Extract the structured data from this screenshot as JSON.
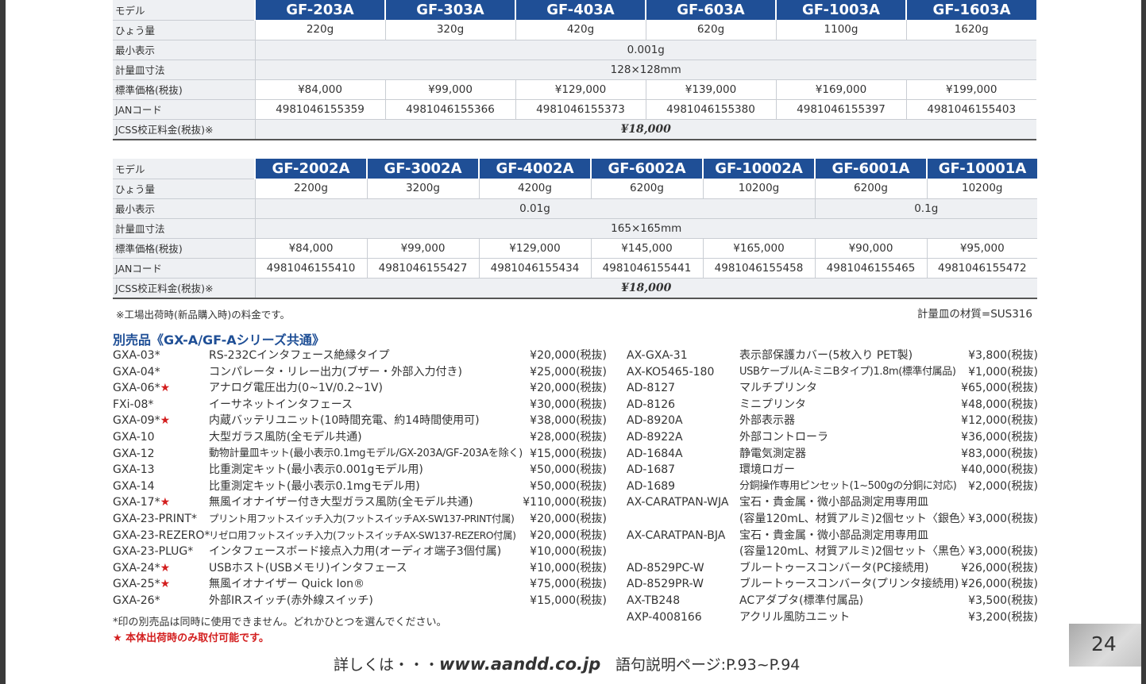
{
  "table1": {
    "rows": {
      "model": "モデル",
      "capacity": "ひょう量",
      "resolution": "最小表示",
      "pan": "計量皿寸法",
      "price": "標準価格(税抜)",
      "jan": "JANコード",
      "jcss": "JCSS校正料金(税抜)※"
    },
    "models": [
      "GF-203A",
      "GF-303A",
      "GF-403A",
      "GF-603A",
      "GF-1003A",
      "GF-1603A"
    ],
    "capacity": [
      "220g",
      "320g",
      "420g",
      "620g",
      "1100g",
      "1620g"
    ],
    "resolution": "0.001g",
    "pan": "128×128mm",
    "price": [
      "¥84,000",
      "¥99,000",
      "¥129,000",
      "¥139,000",
      "¥169,000",
      "¥199,000"
    ],
    "jan": [
      "4981046155359",
      "4981046155366",
      "4981046155373",
      "4981046155380",
      "4981046155397",
      "4981046155403"
    ],
    "jcss": "¥18,000"
  },
  "table2": {
    "rows": {
      "model": "モデル",
      "capacity": "ひょう量",
      "resolution": "最小表示",
      "pan": "計量皿寸法",
      "price": "標準価格(税抜)",
      "jan": "JANコード",
      "jcss": "JCSS校正料金(税抜)※"
    },
    "models": [
      "GF-2002A",
      "GF-3002A",
      "GF-4002A",
      "GF-6002A",
      "GF-10002A",
      "GF-6001A",
      "GF-10001A"
    ],
    "capacity": [
      "2200g",
      "3200g",
      "4200g",
      "6200g",
      "10200g",
      "6200g",
      "10200g"
    ],
    "resolution_a": "0.01g",
    "resolution_b": "0.1g",
    "pan": "165×165mm",
    "price": [
      "¥84,000",
      "¥99,000",
      "¥129,000",
      "¥145,000",
      "¥165,000",
      "¥90,000",
      "¥95,000"
    ],
    "jan": [
      "4981046155410",
      "4981046155427",
      "4981046155434",
      "4981046155441",
      "4981046155458",
      "4981046155465",
      "4981046155472"
    ],
    "jcss": "¥18,000"
  },
  "notes": {
    "factory": "※工場出荷時(新品購入時)の料金です。",
    "pan_material": "計量皿の材質=SUS316"
  },
  "accessories": {
    "title": "別売品《GX-A/GF-Aシリーズ共通》",
    "left": [
      {
        "code": "GXA-03*",
        "red": "",
        "desc": "RS-232Cインタフェース絶縁タイプ",
        "price": "¥20,000(税抜)"
      },
      {
        "code": "GXA-04*",
        "red": "",
        "desc": "コンパレータ・リレー出力(ブザー・外部入力付き)",
        "price": "¥25,000(税抜)"
      },
      {
        "code": "GXA-06*",
        "red": "★",
        "desc": "アナログ電圧出力(0~1V/0.2~1V)",
        "price": "¥20,000(税抜)"
      },
      {
        "code": "FXi-08*",
        "red": "",
        "desc": "イーサネットインタフェース",
        "price": "¥30,000(税抜)"
      },
      {
        "code": "GXA-09*",
        "red": "★",
        "desc": "内蔵バッテリユニット(10時間充電、約14時間使用可)",
        "price": "¥38,000(税抜)"
      },
      {
        "code": "GXA-10",
        "red": "",
        "desc": "大型ガラス風防(全モデル共通)",
        "price": "¥28,000(税抜)"
      },
      {
        "code": "GXA-12",
        "red": "",
        "desc": "動物計量皿キット(最小表示0.1mgモデル/GX-203A/GF-203Aを除く)",
        "price": "¥15,000(税抜)"
      },
      {
        "code": "GXA-13",
        "red": "",
        "desc": "比重測定キット(最小表示0.001gモデル用)",
        "price": "¥50,000(税抜)"
      },
      {
        "code": "GXA-14",
        "red": "",
        "desc": "比重測定キット(最小表示0.1mgモデル用)",
        "price": "¥50,000(税抜)"
      },
      {
        "code": "GXA-17*",
        "red": "★",
        "desc": "無風イオナイザー付き大型ガラス風防(全モデル共通)",
        "price": "¥110,000(税抜)"
      },
      {
        "code": "GXA-23-PRINT*",
        "red": "",
        "desc": "プリント用フットスイッチ入力(フットスイッチAX-SW137-PRINT付属)",
        "price": "¥20,000(税抜)"
      },
      {
        "code": "GXA-23-REZERO*",
        "red": "",
        "desc": "リゼロ用フットスイッチ入力(フットスイッチAX-SW137-REZERO付属)",
        "price": "¥20,000(税抜)"
      },
      {
        "code": "GXA-23-PLUG*",
        "red": "",
        "desc": "インタフェースボード接点入力用(オーディオ端子3個付属)",
        "price": "¥10,000(税抜)"
      },
      {
        "code": "GXA-24*",
        "red": "★",
        "desc": "USBホスト(USBメモリ)インタフェース",
        "price": "¥10,000(税抜)"
      },
      {
        "code": "GXA-25*",
        "red": "★",
        "desc": "無風イオナイザー Quick Ion®",
        "price": "¥75,000(税抜)"
      },
      {
        "code": "GXA-26*",
        "red": "",
        "desc": "外部IRスイッチ(赤外線スイッチ)",
        "price": "¥15,000(税抜)"
      }
    ],
    "right": [
      {
        "code": "AX-GXA-31",
        "desc": "表示部保護カバー(5枚入り PET製)",
        "price": "¥3,800(税抜)"
      },
      {
        "code": "AX-KO5465-180",
        "desc": "USBケーブル(A-ミニBタイプ)1.8m(標準付属品)",
        "price": "¥1,000(税抜)"
      },
      {
        "code": "AD-8127",
        "desc": "マルチプリンタ",
        "price": "¥65,000(税抜)"
      },
      {
        "code": "AD-8126",
        "desc": "ミニプリンタ",
        "price": "¥48,000(税抜)"
      },
      {
        "code": "AD-8920A",
        "desc": "外部表示器",
        "price": "¥12,000(税抜)"
      },
      {
        "code": "AD-8922A",
        "desc": "外部コントローラ",
        "price": "¥36,000(税抜)"
      },
      {
        "code": "AD-1684A",
        "desc": "静電気測定器",
        "price": "¥83,000(税抜)"
      },
      {
        "code": "AD-1687",
        "desc": "環境ロガー",
        "price": "¥40,000(税抜)"
      },
      {
        "code": "AD-1689",
        "desc": "分銅操作専用ピンセット(1~500gの分銅に対応)",
        "price": "¥2,000(税抜)"
      },
      {
        "code": "AX-CARATPAN-WJA",
        "desc": "宝石・貴金属・微小部品測定用専用皿",
        "price": ""
      },
      {
        "code": "",
        "desc": "(容量120mL、材質アルミ)2個セット〈銀色〉",
        "price": "¥3,000(税抜)"
      },
      {
        "code": "AX-CARATPAN-BJA",
        "desc": "宝石・貴金属・微小部品測定用専用皿",
        "price": ""
      },
      {
        "code": "",
        "desc": "(容量120mL、材質アルミ)2個セット〈黒色〉",
        "price": "¥3,000(税抜)"
      },
      {
        "code": "AD-8529PC-W",
        "desc": "ブルートゥースコンバータ(PC接続用)",
        "price": "¥26,000(税抜)"
      },
      {
        "code": "AD-8529PR-W",
        "desc": "ブルートゥースコンバータ(プリンタ接続用)",
        "price": "¥26,000(税抜)"
      },
      {
        "code": "AX-TB248",
        "desc": "ACアダプタ(標準付属品)",
        "price": "¥3,500(税抜)"
      },
      {
        "code": "AXP-4008166",
        "desc": "アクリル風防ユニット",
        "price": "¥3,200(税抜)"
      }
    ],
    "footnote1": "*印の別売品は同時に使用できません。どれかひとつを選んでください。",
    "footnote2": "★ 本体出荷時のみ取付可能です。"
  },
  "footer": {
    "detail": "詳しくは・・・",
    "url": "www.aandd.co.jp",
    "glossary": "語句説明ページ:P.93~P.94",
    "page": "24"
  },
  "colors": {
    "header_blue": "#1f4f96",
    "shade": "#eef0f3",
    "red": "#d31f1f"
  }
}
